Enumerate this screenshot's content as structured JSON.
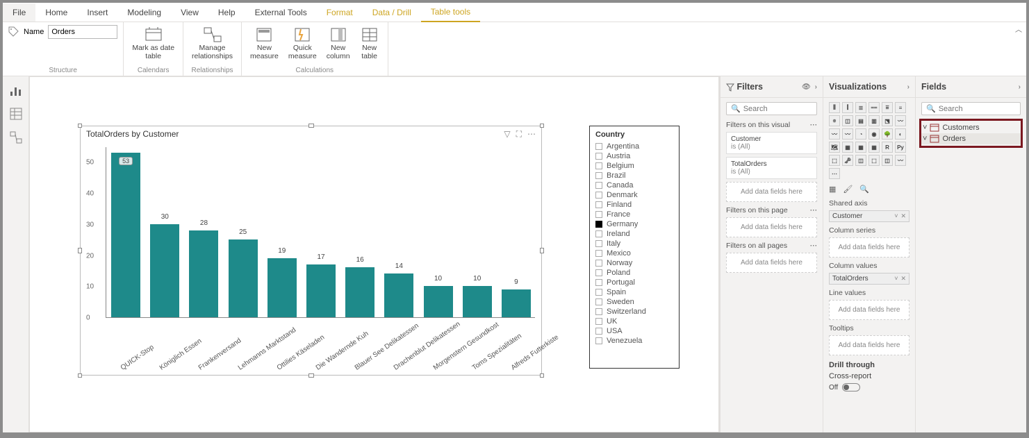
{
  "menu": {
    "file": "File",
    "home": "Home",
    "insert": "Insert",
    "modeling": "Modeling",
    "view": "View",
    "help": "Help",
    "external": "External Tools",
    "format": "Format",
    "datadrill": "Data / Drill",
    "tabletools": "Table tools"
  },
  "ribbon": {
    "name_label": "Name",
    "name_value": "Orders",
    "markdate": "Mark as date\ntable",
    "markdate_grp": "Calendars",
    "managerel": "Manage\nrelationships",
    "managerel_grp": "Relationships",
    "newmeasure": "New\nmeasure",
    "quickmeasure": "Quick\nmeasure",
    "newcolumn": "New\ncolumn",
    "newtable": "New\ntable",
    "calc_grp": "Calculations",
    "structure_grp": "Structure"
  },
  "chart_data": {
    "type": "bar",
    "title": "TotalOrders by Customer",
    "ylabel": "",
    "ylim": [
      0,
      55
    ],
    "yticks": [
      0,
      10,
      20,
      30,
      40,
      50
    ],
    "categories": [
      "QUICK-Stop",
      "Königlich Essen",
      "Frankenversand",
      "Lehmanns Marktstand",
      "Ottilies Käseladen",
      "Die Wandernde Kuh",
      "Blauer See Delikatessen",
      "Drachenblut Delikatessen",
      "Morgenstern Gesundkost",
      "Toms Spezialitäten",
      "Alfreds Futterkiste"
    ],
    "values": [
      53,
      30,
      28,
      25,
      19,
      17,
      16,
      14,
      10,
      10,
      9
    ]
  },
  "slicer": {
    "title": "Country",
    "items": [
      "Argentina",
      "Austria",
      "Belgium",
      "Brazil",
      "Canada",
      "Denmark",
      "Finland",
      "France",
      "Germany",
      "Ireland",
      "Italy",
      "Mexico",
      "Norway",
      "Poland",
      "Portugal",
      "Spain",
      "Sweden",
      "Switzerland",
      "UK",
      "USA",
      "Venezuela"
    ],
    "selected": "Germany"
  },
  "filters": {
    "title": "Filters",
    "search_ph": "Search",
    "on_visual": "Filters on this visual",
    "cards": [
      {
        "name": "Customer",
        "sub": "is (All)"
      },
      {
        "name": "TotalOrders",
        "sub": "is (All)"
      }
    ],
    "add": "Add data fields here",
    "on_page": "Filters on this page",
    "on_all": "Filters on all pages"
  },
  "viz": {
    "title": "Visualizations",
    "shared_axis": "Shared axis",
    "shared_axis_chip": "Customer",
    "col_series": "Column series",
    "col_values": "Column values",
    "col_values_chip": "TotalOrders",
    "line_values": "Line values",
    "tooltips": "Tooltips",
    "add": "Add data fields here",
    "drill": "Drill through",
    "cross": "Cross-report",
    "off": "Off"
  },
  "fields": {
    "title": "Fields",
    "search_ph": "Search",
    "tables": [
      "Customers",
      "Orders"
    ]
  }
}
